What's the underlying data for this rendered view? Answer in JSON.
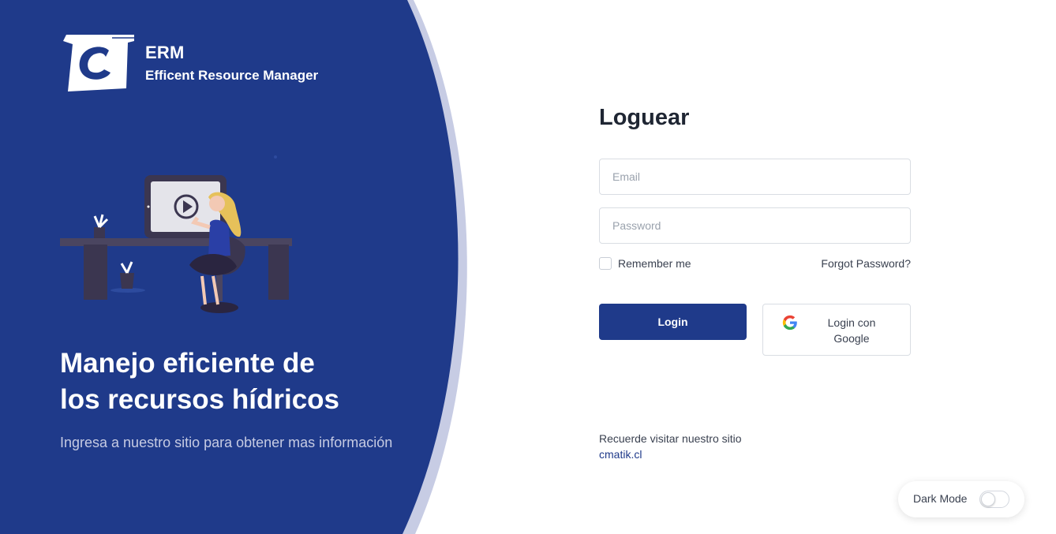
{
  "brand": {
    "title": "ERM",
    "subtitle": "Efficent Resource Manager",
    "logo_icon": "c-logo-icon"
  },
  "hero": {
    "title_line1": "Manejo eficiente de",
    "title_line2": "los recursos hídricos",
    "subtitle": "Ingresa a nuestro sitio para obtener mas información",
    "illustration": "woman-at-computer-illustration"
  },
  "form": {
    "title": "Loguear",
    "email_placeholder": "Email",
    "password_placeholder": "Password",
    "remember_label": "Remember me",
    "forgot_label": "Forgot Password?",
    "login_label": "Login",
    "google_label": "Login con Google",
    "google_icon": "google-icon"
  },
  "footer": {
    "visit_text": "Recuerde visitar nuestro sitio",
    "visit_link": "cmatik.cl"
  },
  "dark_mode": {
    "label": "Dark Mode",
    "enabled": false
  },
  "colors": {
    "panel_blue": "#1f3a8a",
    "panel_outline": "#c7cce4",
    "accent": "#1f3a8a"
  }
}
